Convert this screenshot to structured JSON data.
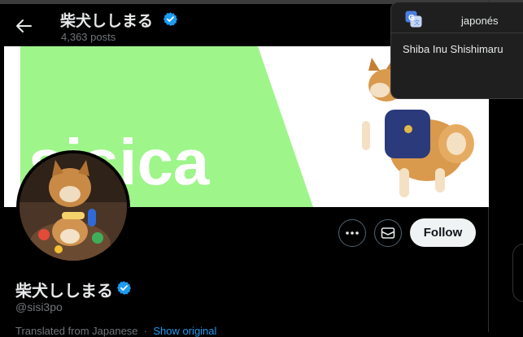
{
  "header": {
    "name": "柴犬ししまる",
    "posts": "4,363 posts"
  },
  "banner": {
    "logo_text": "sisica"
  },
  "profile": {
    "name": "柴犬ししまる",
    "handle": "@sisi3po",
    "follow_label": "Follow",
    "translated_prefix": "Translated from Japanese",
    "show_original": "Show original"
  },
  "translate_popup": {
    "language": "japonés",
    "translation": "Shiba Inu Shishimaru"
  },
  "colors": {
    "background": "#000000",
    "verified": "#1d9bf0",
    "banner_green": "#9ef58a",
    "follow_bg": "#eff3f4"
  }
}
